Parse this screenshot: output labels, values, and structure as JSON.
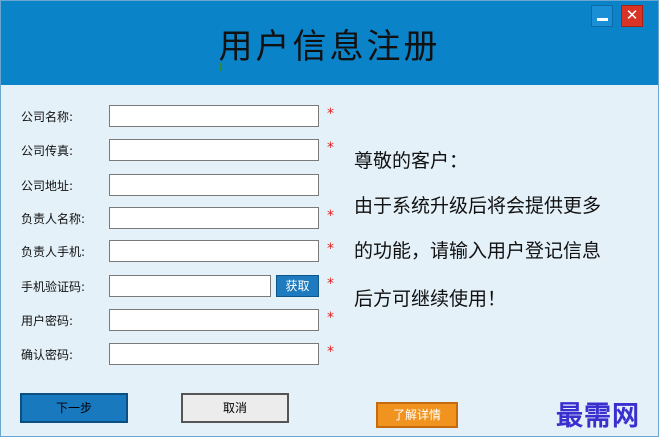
{
  "window": {
    "title": "用户信息注册",
    "minimize_icon": "minimize-icon",
    "close_icon": "close-icon",
    "close_glyph": "✕"
  },
  "form": {
    "fields": [
      {
        "label": "公司名称:",
        "value": "",
        "required": "*"
      },
      {
        "label": "公司传真:",
        "value": "",
        "required": "*"
      },
      {
        "label": "公司地址:",
        "value": "",
        "required": ""
      },
      {
        "label": "负责人名称:",
        "value": "",
        "required": "*"
      },
      {
        "label": "负责人手机:",
        "value": "",
        "required": "*"
      },
      {
        "label": "手机验证码:",
        "value": "",
        "required": "*"
      },
      {
        "label": "用户密码:",
        "value": "",
        "required": "*"
      },
      {
        "label": "确认密码:",
        "value": "",
        "required": "*"
      }
    ],
    "get_code_label": "获取"
  },
  "notice": {
    "greeting": "尊敬的客户：",
    "line1": "由于系统升级后将会提供更多",
    "line2": "的功能，请输入用户登记信息",
    "line3": "后方可继续使用！"
  },
  "actions": {
    "next_label": "下一步",
    "cancel_label": "取消",
    "more_label": "了解详情"
  },
  "brand": {
    "text": "最需网"
  },
  "colors": {
    "titlebar": "#0b83c9",
    "background": "#e4f1f9",
    "required": "#e02020",
    "accent_button": "#1979bf",
    "details_button": "#f0941f",
    "brand": "#3b2fd0"
  }
}
